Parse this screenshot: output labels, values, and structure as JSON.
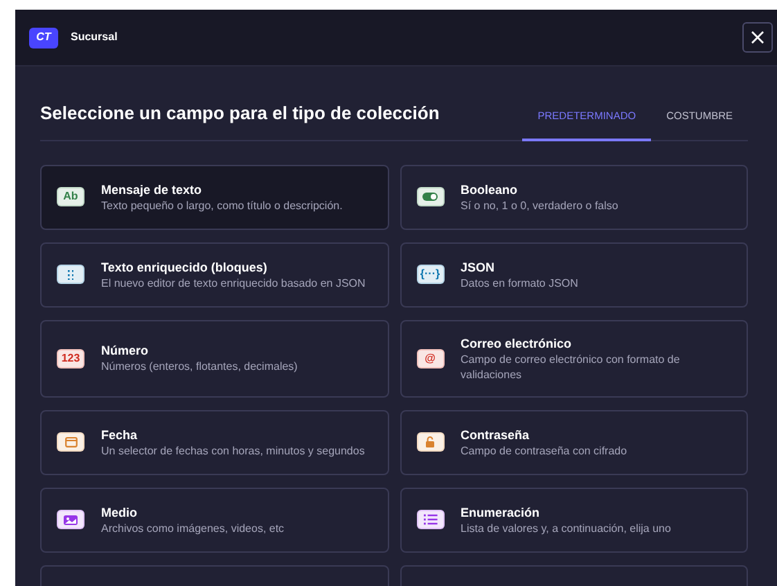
{
  "header": {
    "logo": "CT",
    "title": "Sucursal"
  },
  "heading": "Seleccione un campo para el tipo de colección",
  "tabs": [
    {
      "label": "PREDETERMINADO",
      "selected": true
    },
    {
      "label": "COSTUMBRE",
      "selected": false
    }
  ],
  "fields": [
    {
      "kind": "text",
      "badge": "Ab",
      "title": "Mensaje de texto",
      "description": "Texto pequeño o largo, como título o descripción.",
      "color": "#328048",
      "selected": true
    },
    {
      "kind": "toggle",
      "title": "Booleano",
      "description": "Sí o no, 1 o 0, verdadero o falso",
      "color": "#328048",
      "selected": false
    },
    {
      "kind": "blocks",
      "title": "Texto enriquecido (bloques)",
      "description": "El nuevo editor de texto enriquecido basado en JSON",
      "color": "#0c75af",
      "selected": false
    },
    {
      "kind": "text",
      "badge": "{···}",
      "title": "JSON",
      "description": "Datos en formato JSON",
      "color": "#0c75af",
      "selected": false
    },
    {
      "kind": "text",
      "badge": "123",
      "title": "Número",
      "description": "Números (enteros, flotantes, decimales)",
      "color": "#d02b20",
      "selected": false
    },
    {
      "kind": "text",
      "badge": "@",
      "title": "Correo electrónico",
      "description": "Campo de correo electrónico con formato de validaciones",
      "color": "#d02b20",
      "selected": false
    },
    {
      "kind": "calendar",
      "title": "Fecha",
      "description": "Un selector de fechas con horas, minutos y segundos",
      "color": "#d9822f",
      "selected": false
    },
    {
      "kind": "lock",
      "title": "Contraseña",
      "description": "Campo de contraseña con cifrado",
      "color": "#d9822f",
      "selected": false
    },
    {
      "kind": "media",
      "title": "Medio",
      "description": "Archivos como imágenes, videos, etc",
      "color": "#9736e8",
      "selected": false
    },
    {
      "kind": "list",
      "title": "Enumeración",
      "description": "Lista de valores y, a continuación, elija uno",
      "color": "#9736e8",
      "selected": false
    }
  ]
}
